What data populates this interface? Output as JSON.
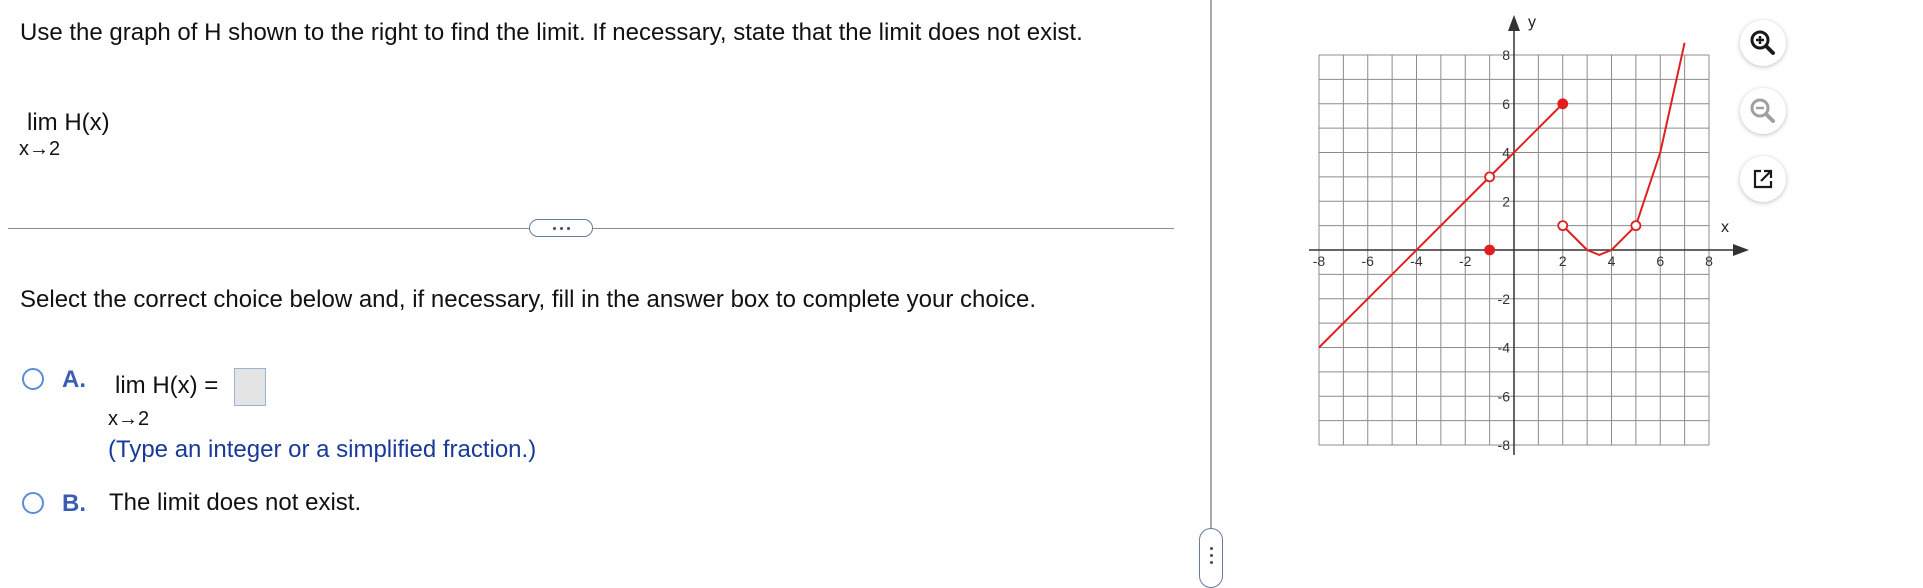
{
  "question": {
    "text": "Use the graph of H shown to the right to find the limit. If necessary, state that the limit does not exist."
  },
  "limit": {
    "expression": "lim H(x)",
    "subscript": "x→2"
  },
  "instruction": "Select the correct choice below and, if necessary, fill in the answer box to complete your choice.",
  "choices": {
    "a": {
      "letter": "A.",
      "expression": "lim H(x) =",
      "subscript": "x→2",
      "answer_value": "",
      "hint": "(Type an integer or a simplified fraction.)"
    },
    "b": {
      "letter": "B.",
      "text": "The limit does not exist."
    }
  },
  "graph": {
    "x_axis_label": "x",
    "y_axis_label": "y",
    "x_tick_labels": [
      "-8",
      "-6",
      "-4",
      "-2",
      "2",
      "4",
      "6",
      "8"
    ],
    "y_tick_labels": [
      "8",
      "6",
      "4",
      "2",
      "-2",
      "-4",
      "-6",
      "-8"
    ],
    "curve_color": "#e02020"
  },
  "chart_data": {
    "type": "line",
    "xlim": [
      -8,
      8
    ],
    "ylim": [
      -8,
      8
    ],
    "grid": true,
    "xlabel": "x",
    "ylabel": "y",
    "series": [
      {
        "values_xy": [
          [
            -8,
            -4
          ],
          [
            -1,
            3
          ],
          [
            2,
            6
          ]
        ]
      },
      {
        "values_xy": [
          [
            2,
            1
          ],
          [
            3,
            0
          ],
          [
            3.5,
            -0.2
          ],
          [
            4,
            0
          ],
          [
            5,
            1
          ],
          [
            6,
            4
          ],
          [
            7,
            8.5
          ]
        ]
      }
    ],
    "points": [
      {
        "x": -1,
        "y": 3,
        "filled": false
      },
      {
        "x": 2,
        "y": 6,
        "filled": true
      },
      {
        "x": -1,
        "y": 0,
        "filled": true
      },
      {
        "x": 2,
        "y": 1,
        "filled": false
      },
      {
        "x": 5,
        "y": 1,
        "filled": false
      }
    ]
  },
  "tools": {
    "zoom_in": "zoom-in",
    "zoom_out": "zoom-out",
    "popout": "external-window"
  }
}
